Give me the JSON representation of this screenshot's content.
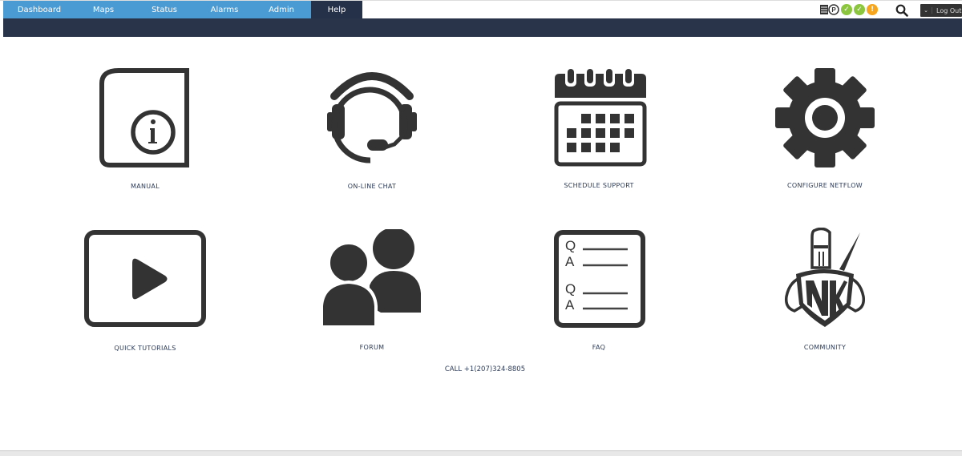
{
  "nav": {
    "tabs": [
      {
        "label": "Dashboard",
        "active": false
      },
      {
        "label": "Maps",
        "active": false
      },
      {
        "label": "Status",
        "active": false
      },
      {
        "label": "Alarms",
        "active": false
      },
      {
        "label": "Admin",
        "active": false
      },
      {
        "label": "Help",
        "active": true
      }
    ]
  },
  "header": {
    "status_icons": [
      {
        "name": "network-icon",
        "symbol": "P"
      },
      {
        "name": "status-ok",
        "symbol": "✓",
        "color": "#8cc63f"
      },
      {
        "name": "status-ok",
        "symbol": "✓",
        "color": "#8cc63f"
      },
      {
        "name": "status-warning",
        "symbol": "!",
        "color": "#f7a51c"
      }
    ],
    "search_icon": "search-icon",
    "logout_label": "Log Out"
  },
  "help": {
    "tiles": [
      {
        "label": "MANUAL",
        "icon": "manual-icon"
      },
      {
        "label": "ON-LINE CHAT",
        "icon": "headset-icon"
      },
      {
        "label": "SCHEDULE SUPPORT",
        "icon": "calendar-icon"
      },
      {
        "label": "CONFIGURE NETFLOW",
        "icon": "gear-icon"
      },
      {
        "label": "QUICK TUTORIALS",
        "icon": "play-icon"
      },
      {
        "label": "FORUM",
        "icon": "users-icon"
      },
      {
        "label": "FAQ",
        "icon": "faq-icon"
      },
      {
        "label": "COMMUNITY",
        "icon": "knight-icon"
      }
    ],
    "faq_letters": [
      "Q",
      "A",
      "Q",
      "A"
    ],
    "call": "CALL +1(207)324-8805"
  },
  "colors": {
    "nav_bg": "#4a9bd4",
    "nav_active": "#253049",
    "dark_bar": "#29334a",
    "icon": "#333333"
  }
}
